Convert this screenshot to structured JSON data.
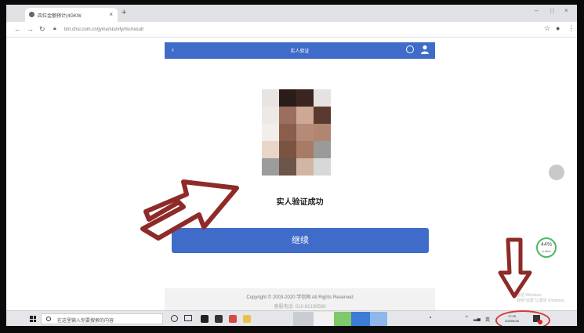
{
  "browser": {
    "tab_title": "四位金额预计(4GKW",
    "url": "bm.chsi.com.cn/jymu/stu/vfy/mc/result",
    "window_controls": [
      "–",
      "□",
      "×"
    ],
    "new_tab": "+",
    "icons": [
      "back-icon",
      "forward-icon",
      "reload-icon",
      "lock-icon",
      "star-icon",
      "profile-icon",
      "menu-icon"
    ]
  },
  "app": {
    "header_title": "实人验证",
    "back_label": "‹",
    "status": "实人验证成功",
    "continue_label": "继续",
    "footer_copyright": "Copyright © 2003-2020 学信网 All Rights Reserved",
    "footer_line2": "客服电话: 010-82199588"
  },
  "overlay": {
    "net_speed": "44%",
    "net_speed_sub": "0.4K/s",
    "watermark": "激活 Windows\n转到\"设置\"以激活 Windows。"
  },
  "taskbar": {
    "search_placeholder": "在这里输入你要搜索的内容",
    "clock_time": "17:25",
    "clock_date": "2020/6/18",
    "tray_text": "英"
  },
  "colors": {
    "accent": "#3f6cc9",
    "arrow_red": "#8e2b28",
    "ring_red": "#d63a35",
    "meter_green": "#49b95e"
  }
}
